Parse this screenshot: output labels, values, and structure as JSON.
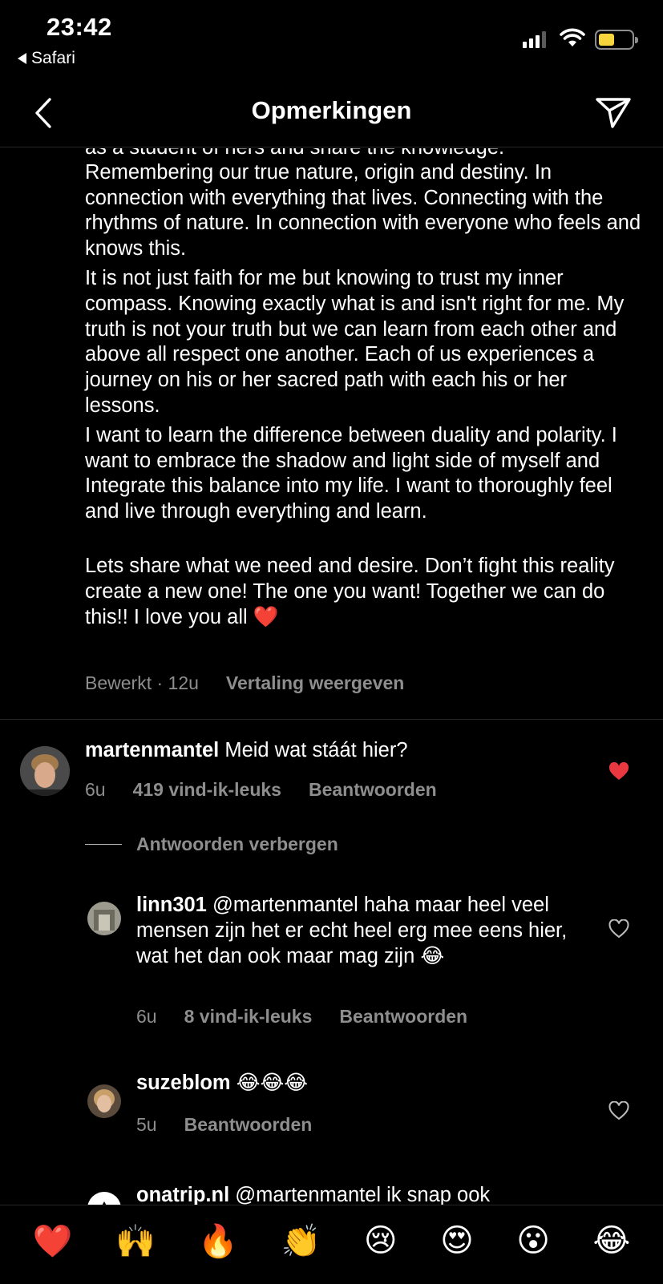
{
  "status_bar": {
    "time": "23:42",
    "back_app": "Safari"
  },
  "header": {
    "title": "Opmerkingen"
  },
  "caption": {
    "cut_line": "as a student of hers and share the knowledge.",
    "paragraphs": [
      "Remembering our true nature, origin and destiny. In connection with everything that lives. Connecting with the rhythms of nature. In connection with everyone who feels and knows this.",
      "It is not just faith for me but knowing to trust my inner compass. Knowing exactly what is and isn't right for me. My truth is not your truth but we can learn from each other and above all respect one another. Each of us experiences a journey on his or her sacred path with each his or her lessons.",
      "I want to learn the difference between duality and polarity. I want to embrace the shadow and light side of myself and Integrate this balance into my life. I want to thoroughly feel and live through everything and learn.",
      "Lets share what we need and desire. Don’t fight this reality create a new one! The one you want! Together we can do this!! I love you all"
    ],
    "heart_emoji": "❤️",
    "edited": "Bewerkt · 12u",
    "translate": "Vertaling weergeven"
  },
  "comments": [
    {
      "username": "martenmantel",
      "text": "Meid wat stáát hier?",
      "time": "6u",
      "likes": "419 vind-ik-leuks",
      "reply": "Beantwoorden",
      "liked": true
    }
  ],
  "hide_replies": "Antwoorden verbergen",
  "replies": [
    {
      "username": "linn301",
      "text": "@martenmantel haha maar heel veel mensen zijn het er echt heel erg mee eens hier, wat het dan ook maar mag zijn",
      "emoji": "😂",
      "time": "6u",
      "likes": "8 vind-ik-leuks",
      "reply": "Beantwoorden"
    },
    {
      "username": "suzeblom",
      "text": "😂😂😂",
      "time": "5u",
      "reply": "Beantwoorden"
    },
    {
      "username": "onatrip.nl",
      "text": "@martenmantel ik snap ook"
    }
  ],
  "reactions": [
    "❤️",
    "🙌",
    "🔥",
    "👏",
    "😢",
    "😍",
    "😮",
    "😂"
  ],
  "colors": {
    "accent_red": "#e9383f",
    "muted": "#8e8e8e",
    "battery": "#f7d53c"
  }
}
